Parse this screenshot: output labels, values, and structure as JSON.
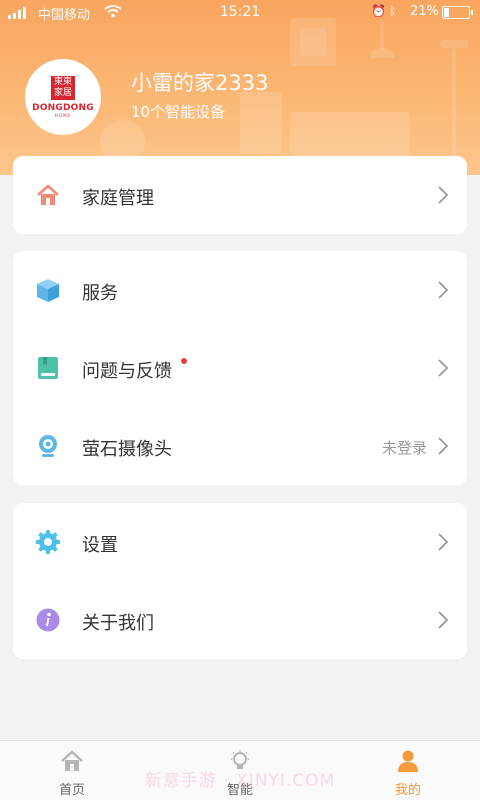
{
  "status_bar": {
    "carrier": "中国移动",
    "time": "15:21",
    "battery": "21%",
    "battery_level": 0.21
  },
  "profile": {
    "logo_chars": [
      "東東",
      "家居"
    ],
    "logo_brand": "DONGDONG",
    "logo_sub": "HOME",
    "home_name": "小雷的家2333",
    "device_count": "10个智能设备"
  },
  "menu": {
    "family": {
      "label": "家庭管理"
    },
    "service": {
      "label": "服务"
    },
    "feedback": {
      "label": "问题与反馈"
    },
    "camera": {
      "label": "萤石摄像头",
      "value": "未登录"
    },
    "settings": {
      "label": "设置"
    },
    "about": {
      "label": "关于我们"
    }
  },
  "tabs": {
    "home": {
      "label": "首页"
    },
    "smart": {
      "label": "智能"
    },
    "mine": {
      "label": "我的"
    }
  },
  "watermark": "新意手游 · XINYI.COM",
  "colors": {
    "header_start": "#f9a55f",
    "accent": "#f39a3b",
    "home_icon": "#f28a7a",
    "service_icon": "#5fb6ea",
    "feedback_icon": "#4dc2a8",
    "camera_icon": "#5fb6ea",
    "settings_icon": "#4cc0e8",
    "about_icon": "#a98ae6",
    "red_dot": "#f23b3b"
  }
}
